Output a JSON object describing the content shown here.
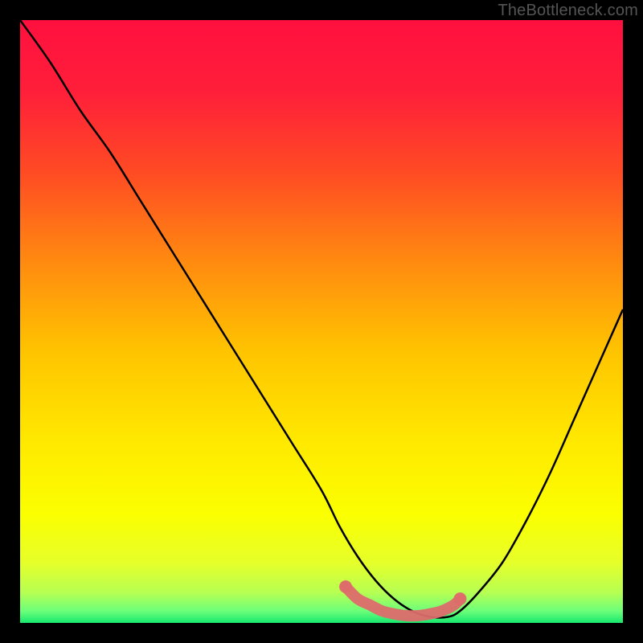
{
  "watermark": "TheBottleneck.com",
  "gradient_stops": [
    {
      "offset": 0.0,
      "color": "#ff103f"
    },
    {
      "offset": 0.12,
      "color": "#ff1f3a"
    },
    {
      "offset": 0.25,
      "color": "#ff4a24"
    },
    {
      "offset": 0.4,
      "color": "#ff8a10"
    },
    {
      "offset": 0.55,
      "color": "#ffc400"
    },
    {
      "offset": 0.7,
      "color": "#ffe900"
    },
    {
      "offset": 0.82,
      "color": "#fbff00"
    },
    {
      "offset": 0.9,
      "color": "#e6ff2a"
    },
    {
      "offset": 0.95,
      "color": "#b6ff53"
    },
    {
      "offset": 0.98,
      "color": "#6dff7a"
    },
    {
      "offset": 1.0,
      "color": "#17e86f"
    }
  ],
  "chart_data": {
    "type": "line",
    "title": "",
    "xlabel": "",
    "ylabel": "",
    "xlim": [
      0,
      100
    ],
    "ylim": [
      0,
      100
    ],
    "series": [
      {
        "name": "bottleneck-curve",
        "x": [
          0,
          5,
          10,
          15,
          20,
          25,
          30,
          35,
          40,
          45,
          50,
          53,
          56,
          59,
          62,
          65,
          68,
          71,
          73,
          76,
          80,
          84,
          88,
          92,
          96,
          100
        ],
        "values": [
          100,
          93,
          85,
          78,
          70,
          62,
          54,
          46,
          38,
          30,
          22,
          16,
          11,
          7,
          4,
          2,
          1,
          1,
          2,
          5,
          10,
          17,
          25,
          34,
          43,
          52
        ]
      }
    ],
    "markers": {
      "name": "optimal-zone",
      "color": "#dd6b6b",
      "x": [
        54,
        56,
        58,
        60,
        62,
        64,
        66,
        68,
        70,
        72,
        73
      ],
      "values": [
        6,
        4,
        3,
        2,
        1.5,
        1.2,
        1.2,
        1.5,
        2,
        3,
        4
      ]
    }
  }
}
